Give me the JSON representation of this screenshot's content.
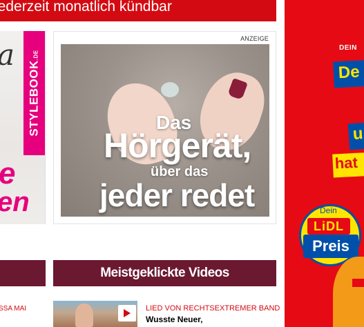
{
  "top_banner": {
    "text": "jederzeit monatlich kündbar"
  },
  "left_ad": {
    "script_letter": "a",
    "brand": "STYLEBOOK",
    "brand_suffix": ".DE",
    "big_line1": "e",
    "big_line2": "en"
  },
  "center_ad": {
    "label": "ANZEIGE",
    "line1": "Das",
    "line2": "Hörgerät,",
    "line3": "über das",
    "line4": "jeder redet"
  },
  "sections": {
    "videos_title": "Meistgeklickte Videos"
  },
  "teasers": {
    "left_kicker": "SSA MAI",
    "video_kicker": "LIED VON RECHTSEXTREMER BAND",
    "video_headline": "Wusste Neuer,"
  },
  "lidl_ad": {
    "dein_small": "DEIN",
    "word1": "De",
    "word2": "u",
    "word3": "hat",
    "badge_dein": "Dein",
    "badge_brand": "LiDL",
    "badge_preis": "Preis"
  },
  "colors": {
    "bild_red": "#d40a12",
    "section_bg": "#6b1831",
    "lidl_red": "#e60a14",
    "lidl_yellow": "#ffe500",
    "lidl_blue": "#0050aa",
    "stylebook_pink": "#e6007e"
  }
}
